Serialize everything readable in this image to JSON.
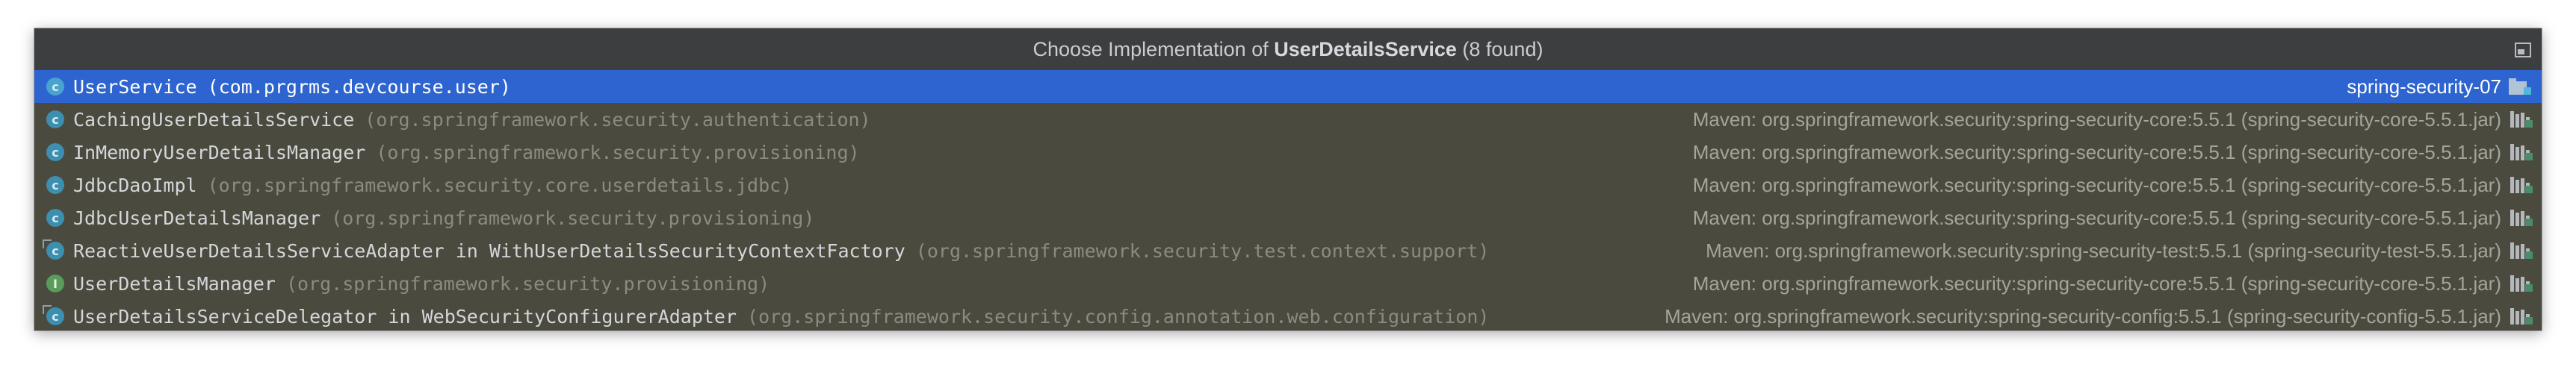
{
  "popup": {
    "title_prefix": "Choose Implementation of ",
    "title_bold": "UserDetailsService",
    "title_suffix": " (8 found)",
    "colors": {
      "background": "#4b4a3f",
      "selected": "#2e64cf",
      "title_bar": "#3d3e40"
    }
  },
  "items": [
    {
      "name": "UserService",
      "package": "(com.prgrms.devcourse.user)",
      "location": "spring-security-07",
      "icon": "class-icon",
      "location_icon": "module-folder-icon",
      "selected": true
    },
    {
      "name": "CachingUserDetailsService",
      "package": "(org.springframework.security.authentication)",
      "location": "Maven: org.springframework.security:spring-security-core:5.5.1 (spring-security-core-5.5.1.jar)",
      "icon": "class-icon",
      "location_icon": "library-jar-icon",
      "selected": false
    },
    {
      "name": "InMemoryUserDetailsManager",
      "package": "(org.springframework.security.provisioning)",
      "location": "Maven: org.springframework.security:spring-security-core:5.5.1 (spring-security-core-5.5.1.jar)",
      "icon": "class-icon",
      "location_icon": "library-jar-icon",
      "selected": false
    },
    {
      "name": "JdbcDaoImpl",
      "package": "(org.springframework.security.core.userdetails.jdbc)",
      "location": "Maven: org.springframework.security:spring-security-core:5.5.1 (spring-security-core-5.5.1.jar)",
      "icon": "class-icon",
      "location_icon": "library-jar-icon",
      "selected": false
    },
    {
      "name": "JdbcUserDetailsManager",
      "package": "(org.springframework.security.provisioning)",
      "location": "Maven: org.springframework.security:spring-security-core:5.5.1 (spring-security-core-5.5.1.jar)",
      "icon": "class-icon",
      "location_icon": "library-jar-icon",
      "selected": false
    },
    {
      "name": "ReactiveUserDetailsServiceAdapter in WithUserDetailsSecurityContextFactory",
      "package": "(org.springframework.security.test.context.support)",
      "location": "Maven: org.springframework.security:spring-security-test:5.5.1 (spring-security-test-5.5.1.jar)",
      "icon": "inner-class-icon",
      "location_icon": "library-jar-icon",
      "selected": false
    },
    {
      "name": "UserDetailsManager",
      "package": "(org.springframework.security.provisioning)",
      "location": "Maven: org.springframework.security:spring-security-core:5.5.1 (spring-security-core-5.5.1.jar)",
      "icon": "interface-icon",
      "location_icon": "library-jar-icon",
      "selected": false
    },
    {
      "name": "UserDetailsServiceDelegator in WebSecurityConfigurerAdapter",
      "package": "(org.springframework.security.config.annotation.web.configuration)",
      "location": "Maven: org.springframework.security:spring-security-config:5.5.1 (spring-security-config-5.5.1.jar)",
      "icon": "inner-class-icon",
      "location_icon": "library-jar-icon",
      "selected": false
    }
  ]
}
